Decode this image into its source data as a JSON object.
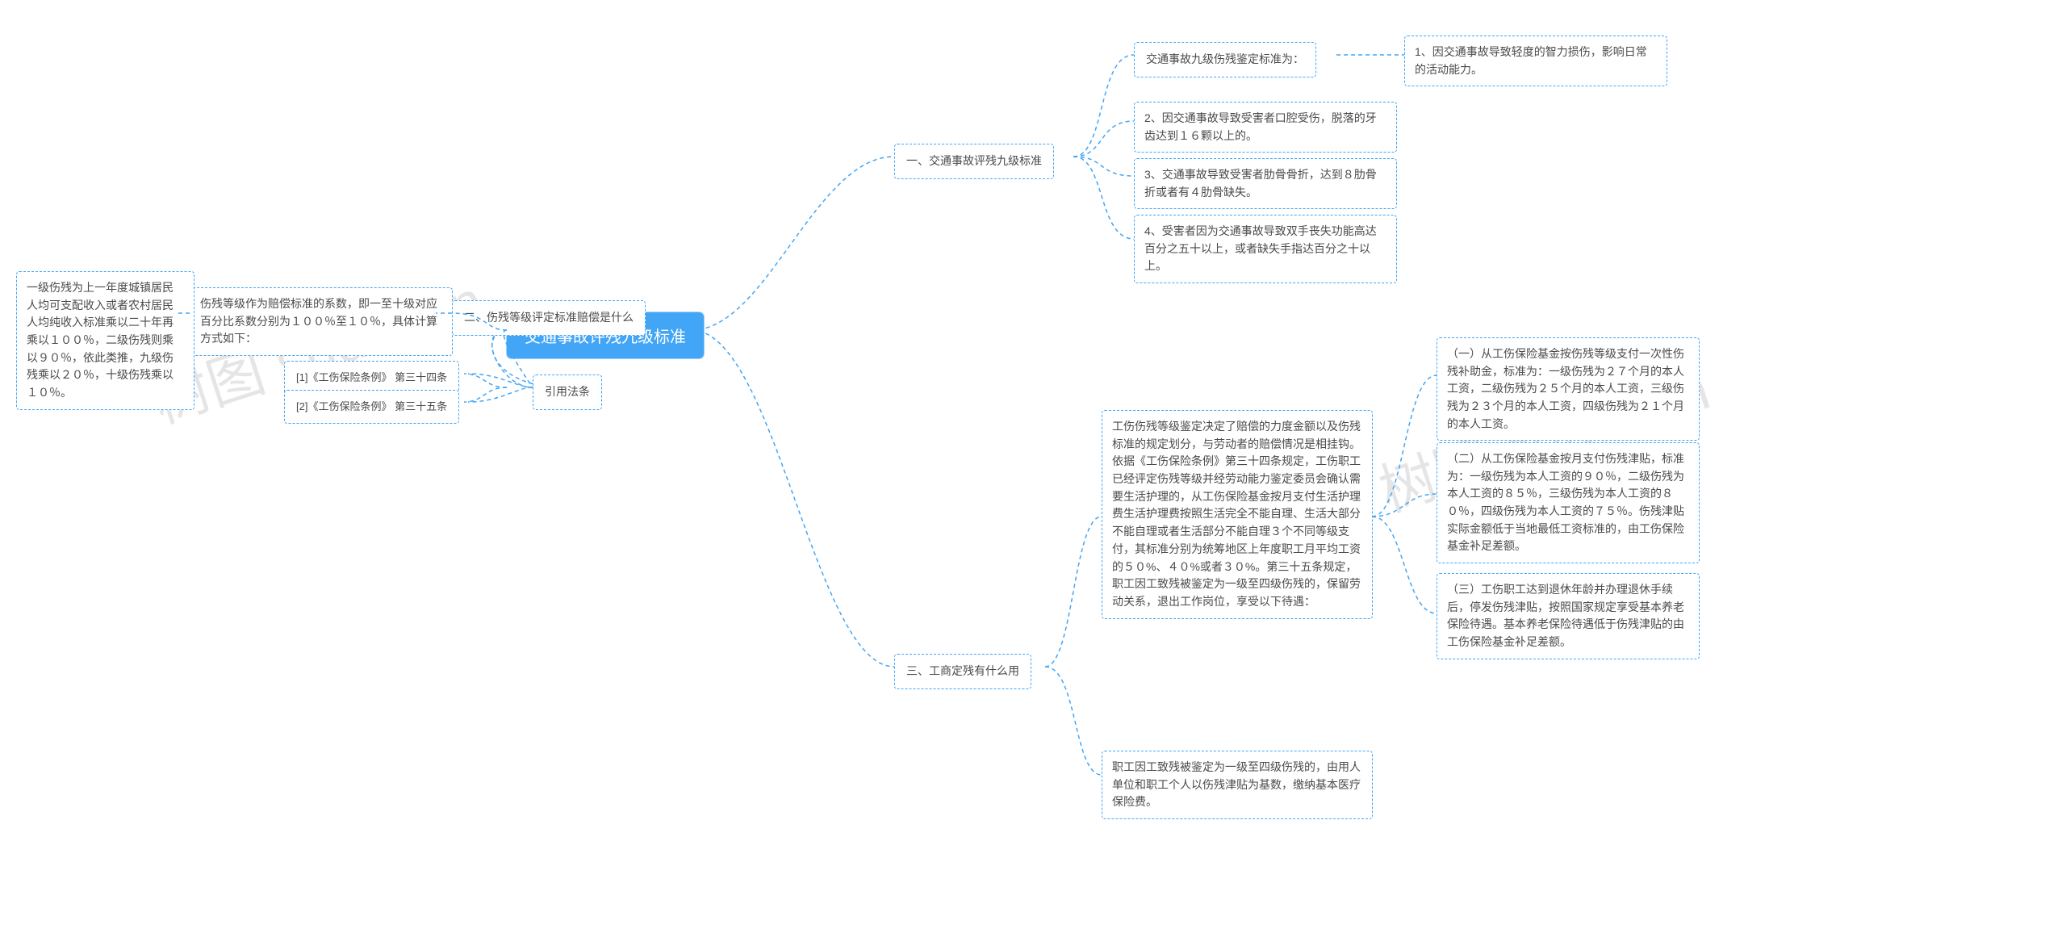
{
  "watermarks": {
    "left": "树图 shutu.cn",
    "right": "树图 shutu.cn"
  },
  "root": "交通事故评残九级标准",
  "branches": {
    "b1": {
      "title": "一、交通事故评残九级标准",
      "c1": {
        "label": "交通事故九级伤残鉴定标准为：",
        "d1": "1、因交通事故导致轻度的智力损伤，影响日常的活动能力。"
      },
      "c2": "2、因交通事故导致受害者口腔受伤，脱落的牙齿达到１６颗以上的。",
      "c3": "3、交通事故导致受害者肋骨骨折，达到８肋骨折或者有４肋骨缺失。",
      "c4": "4、受害者因为交通事故导致双手丧失功能高达百分之五十以上，或者缺失手指达百分之十以上。"
    },
    "b2": {
      "title": "二、伤残等级评定标准赔偿是什么",
      "c1": {
        "text": "伤残等级作为赔偿标准的系数，即一至十级对应百分比系数分别为１００％至１０％，具体计算方式如下：",
        "d1": "一级伤残为上一年度城镇居民人均可支配收入或者农村居民人均纯收入标准乘以二十年再乘以１００％，二级伤残则乘以９０％，依此类推，九级伤残乘以２０％，十级伤残乘以１０％。"
      }
    },
    "b3": {
      "title": "三、工商定残有什么用",
      "c1": {
        "text": "工伤伤残等级鉴定决定了赔偿的力度金额以及伤残标准的规定划分，与劳动者的赔偿情况是相挂钩。依据《工伤保险条例》第三十四条规定，工伤职工已经评定伤残等级并经劳动能力鉴定委员会确认需要生活护理的，从工伤保险基金按月支付生活护理费生活护理费按照生活完全不能自理、生活大部分不能自理或者生活部分不能自理３个不同等级支付，其标准分别为统筹地区上年度职工月平均工资的５０%、４０%或者３０%。第三十五条规定，职工因工致残被鉴定为一级至四级伤残的，保留劳动关系，退出工作岗位，享受以下待遇：",
        "d1": "（一）从工伤保险基金按伤残等级支付一次性伤残补助金，标准为：一级伤残为２７个月的本人工资，二级伤残为２５个月的本人工资，三级伤残为２３个月的本人工资，四级伤残为２１个月的本人工资。",
        "d2": "（二）从工伤保险基金按月支付伤残津贴，标准为：一级伤残为本人工资的９０％，二级伤残为本人工资的８５％，三级伤残为本人工资的８０％，四级伤残为本人工资的７５％。伤残津贴实际金额低于当地最低工资标准的，由工伤保险基金补足差额。",
        "d3": "（三）工伤职工达到退休年龄并办理退休手续后，停发伤残津贴，按照国家规定享受基本养老保险待遇。基本养老保险待遇低于伤残津贴的由工伤保险基金补足差额。"
      },
      "c2": "职工因工致残被鉴定为一级至四级伤残的，由用人单位和职工个人以伤残津贴为基数，缴纳基本医疗保险费。"
    },
    "refs": {
      "title": "引用法条",
      "r1": "[1]《工伤保险条例》 第三十四条",
      "r2": "[2]《工伤保险条例》 第三十五条"
    }
  }
}
